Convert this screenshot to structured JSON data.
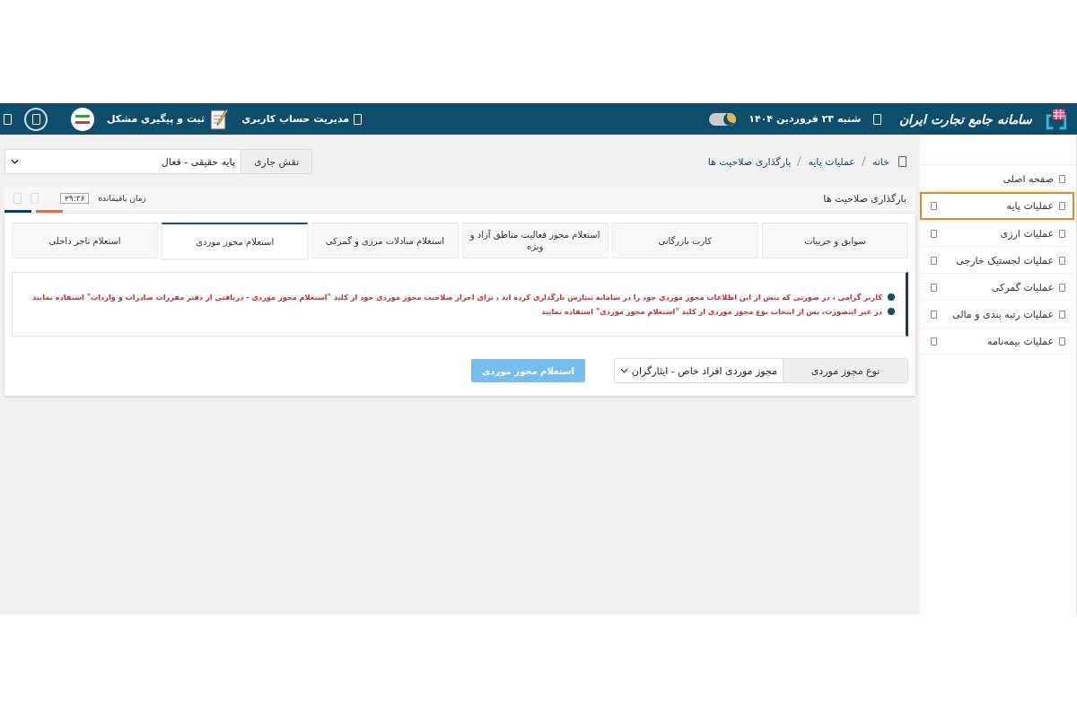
{
  "header": {
    "logo_text": "سامانه جامع تجارت ایران",
    "date": "شنبه ۲۳ فروردین ۱۴۰۴",
    "account_link": "مدیریت حساب کاربری",
    "support_link": "ثبت و پیگیری مشکل"
  },
  "sidebar": {
    "items": [
      {
        "label": "صفحه اصلی",
        "selected": false,
        "expandable": false
      },
      {
        "label": "عملیات پایه",
        "selected": true,
        "expandable": true
      },
      {
        "label": "عملیات ارزی",
        "selected": false,
        "expandable": true
      },
      {
        "label": "عملیات لجستیک خارجی",
        "selected": false,
        "expandable": true
      },
      {
        "label": "عملیات گمرکی",
        "selected": false,
        "expandable": true
      },
      {
        "label": "عملیات رتبه بندی و مالی",
        "selected": false,
        "expandable": true
      },
      {
        "label": "عملیات بیمه‌نامه",
        "selected": false,
        "expandable": true
      }
    ]
  },
  "breadcrumb": [
    "خانه",
    "عملیات پایه",
    "بارگذاری صلاحیت ها"
  ],
  "role": {
    "label": "نقش جاری",
    "value": "پایه حقیقی - فعال"
  },
  "panel": {
    "title": "بارگذاری صلاحیت ها",
    "timer_label": "زمان باقیمانده",
    "timer": "۲۹:۳۶"
  },
  "tabs": [
    {
      "label": "سوابق و جزییات",
      "selected": false
    },
    {
      "label": "کارت بازرگانی",
      "selected": false
    },
    {
      "label": "استعلام مجوز فعالیت مناطق آزاد و ویژه",
      "selected": false
    },
    {
      "label": "استعلام مبادلات مرزی و گمرکی",
      "selected": false
    },
    {
      "label": "استعلام مجوز موردی",
      "selected": true
    },
    {
      "label": "استعلام تاجر داخلی",
      "selected": false
    }
  ],
  "notices": [
    "کاربر گرامی ، در صورتی که پیش از این اطلاعات مجوز موردی خود را در سامانه ثبتارش بارگذاری کرده اید ، برای احراز صلاحیت مجوز موردی خود از کلید \"استعلام مجوز موردی - دریافتی از دفتر مقررات صادرات و واردات\" استفاده نمایید",
    "در غیر اینصورت، پس از انتخاب نوع مجوز موردی از کلید \"استعلام مجوز موردی\" استفاده نمایید"
  ],
  "form": {
    "label": "نوع مجوز موردی",
    "value": "مجوز موردی افراد خاص - ایثارگران",
    "button": {
      "label": "استعلام مجوز موردی",
      "disabled": true
    }
  }
}
